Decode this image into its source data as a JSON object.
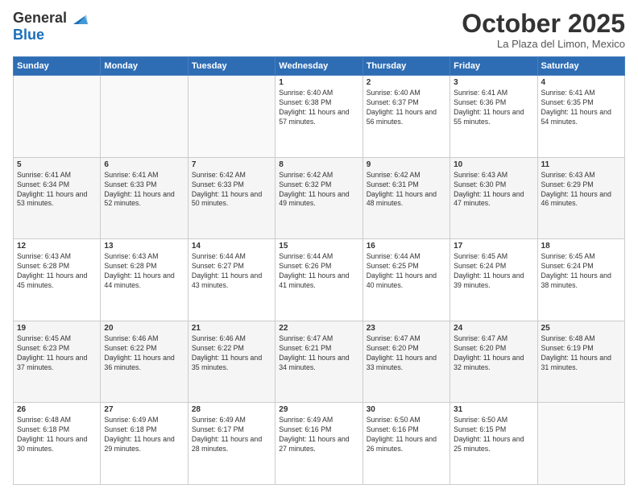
{
  "header": {
    "logo_general": "General",
    "logo_blue": "Blue",
    "month_title": "October 2025",
    "location": "La Plaza del Limon, Mexico"
  },
  "weekdays": [
    "Sunday",
    "Monday",
    "Tuesday",
    "Wednesday",
    "Thursday",
    "Friday",
    "Saturday"
  ],
  "weeks": [
    [
      {
        "day": "",
        "info": ""
      },
      {
        "day": "",
        "info": ""
      },
      {
        "day": "",
        "info": ""
      },
      {
        "day": "1",
        "info": "Sunrise: 6:40 AM\nSunset: 6:38 PM\nDaylight: 11 hours and 57 minutes."
      },
      {
        "day": "2",
        "info": "Sunrise: 6:40 AM\nSunset: 6:37 PM\nDaylight: 11 hours and 56 minutes."
      },
      {
        "day": "3",
        "info": "Sunrise: 6:41 AM\nSunset: 6:36 PM\nDaylight: 11 hours and 55 minutes."
      },
      {
        "day": "4",
        "info": "Sunrise: 6:41 AM\nSunset: 6:35 PM\nDaylight: 11 hours and 54 minutes."
      }
    ],
    [
      {
        "day": "5",
        "info": "Sunrise: 6:41 AM\nSunset: 6:34 PM\nDaylight: 11 hours and 53 minutes."
      },
      {
        "day": "6",
        "info": "Sunrise: 6:41 AM\nSunset: 6:33 PM\nDaylight: 11 hours and 52 minutes."
      },
      {
        "day": "7",
        "info": "Sunrise: 6:42 AM\nSunset: 6:33 PM\nDaylight: 11 hours and 50 minutes."
      },
      {
        "day": "8",
        "info": "Sunrise: 6:42 AM\nSunset: 6:32 PM\nDaylight: 11 hours and 49 minutes."
      },
      {
        "day": "9",
        "info": "Sunrise: 6:42 AM\nSunset: 6:31 PM\nDaylight: 11 hours and 48 minutes."
      },
      {
        "day": "10",
        "info": "Sunrise: 6:43 AM\nSunset: 6:30 PM\nDaylight: 11 hours and 47 minutes."
      },
      {
        "day": "11",
        "info": "Sunrise: 6:43 AM\nSunset: 6:29 PM\nDaylight: 11 hours and 46 minutes."
      }
    ],
    [
      {
        "day": "12",
        "info": "Sunrise: 6:43 AM\nSunset: 6:28 PM\nDaylight: 11 hours and 45 minutes."
      },
      {
        "day": "13",
        "info": "Sunrise: 6:43 AM\nSunset: 6:28 PM\nDaylight: 11 hours and 44 minutes."
      },
      {
        "day": "14",
        "info": "Sunrise: 6:44 AM\nSunset: 6:27 PM\nDaylight: 11 hours and 43 minutes."
      },
      {
        "day": "15",
        "info": "Sunrise: 6:44 AM\nSunset: 6:26 PM\nDaylight: 11 hours and 41 minutes."
      },
      {
        "day": "16",
        "info": "Sunrise: 6:44 AM\nSunset: 6:25 PM\nDaylight: 11 hours and 40 minutes."
      },
      {
        "day": "17",
        "info": "Sunrise: 6:45 AM\nSunset: 6:24 PM\nDaylight: 11 hours and 39 minutes."
      },
      {
        "day": "18",
        "info": "Sunrise: 6:45 AM\nSunset: 6:24 PM\nDaylight: 11 hours and 38 minutes."
      }
    ],
    [
      {
        "day": "19",
        "info": "Sunrise: 6:45 AM\nSunset: 6:23 PM\nDaylight: 11 hours and 37 minutes."
      },
      {
        "day": "20",
        "info": "Sunrise: 6:46 AM\nSunset: 6:22 PM\nDaylight: 11 hours and 36 minutes."
      },
      {
        "day": "21",
        "info": "Sunrise: 6:46 AM\nSunset: 6:22 PM\nDaylight: 11 hours and 35 minutes."
      },
      {
        "day": "22",
        "info": "Sunrise: 6:47 AM\nSunset: 6:21 PM\nDaylight: 11 hours and 34 minutes."
      },
      {
        "day": "23",
        "info": "Sunrise: 6:47 AM\nSunset: 6:20 PM\nDaylight: 11 hours and 33 minutes."
      },
      {
        "day": "24",
        "info": "Sunrise: 6:47 AM\nSunset: 6:20 PM\nDaylight: 11 hours and 32 minutes."
      },
      {
        "day": "25",
        "info": "Sunrise: 6:48 AM\nSunset: 6:19 PM\nDaylight: 11 hours and 31 minutes."
      }
    ],
    [
      {
        "day": "26",
        "info": "Sunrise: 6:48 AM\nSunset: 6:18 PM\nDaylight: 11 hours and 30 minutes."
      },
      {
        "day": "27",
        "info": "Sunrise: 6:49 AM\nSunset: 6:18 PM\nDaylight: 11 hours and 29 minutes."
      },
      {
        "day": "28",
        "info": "Sunrise: 6:49 AM\nSunset: 6:17 PM\nDaylight: 11 hours and 28 minutes."
      },
      {
        "day": "29",
        "info": "Sunrise: 6:49 AM\nSunset: 6:16 PM\nDaylight: 11 hours and 27 minutes."
      },
      {
        "day": "30",
        "info": "Sunrise: 6:50 AM\nSunset: 6:16 PM\nDaylight: 11 hours and 26 minutes."
      },
      {
        "day": "31",
        "info": "Sunrise: 6:50 AM\nSunset: 6:15 PM\nDaylight: 11 hours and 25 minutes."
      },
      {
        "day": "",
        "info": ""
      }
    ]
  ]
}
